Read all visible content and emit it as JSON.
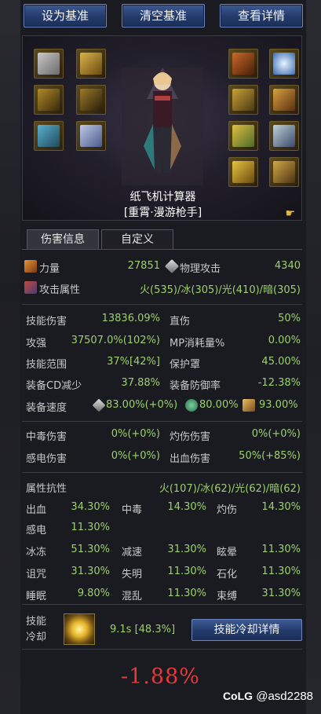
{
  "top_buttons": {
    "set_baseline": "设为基准",
    "clear_baseline": "清空基准",
    "view_details": "查看详情"
  },
  "character": {
    "name": "纸飞机计算器",
    "title": "[重霄·漫游枪手]"
  },
  "tabs": [
    {
      "label": "伤害信息",
      "active": true
    },
    {
      "label": "自定义",
      "active": false
    }
  ],
  "main_stat": {
    "label": "力量",
    "value": "27851",
    "attack_label": "物理攻击",
    "attack_value": "4340"
  },
  "element_attack": {
    "label": "攻击属性",
    "value": "火(535)/冰(305)/光(410)/暗(305)"
  },
  "stats": {
    "skill_damage": {
      "label": "技能伤害",
      "value": "13836.09%"
    },
    "direct_damage": {
      "label": "直伤",
      "value": "50%"
    },
    "attack_power": {
      "label": "攻强",
      "value": "37507.0%(102%)"
    },
    "mp_cost": {
      "label": "MP消耗量%",
      "value": "0.00%"
    },
    "skill_range": {
      "label": "技能范围",
      "value": "37%[42%]"
    },
    "shield": {
      "label": "保护罩",
      "value": "45.00%"
    },
    "cd_reduction": {
      "label": "装备CD减少",
      "value": "37.88%"
    },
    "defense_rate": {
      "label": "装备防御率",
      "value": "-12.38%"
    },
    "speed": {
      "label": "装备速度",
      "attack_speed": "83.00%(+0%)",
      "cast_speed": "80.00%",
      "move_speed": "93.00%"
    }
  },
  "status_damage": {
    "poison": {
      "label": "中毒伤害",
      "value": "0%(+0%)"
    },
    "burn": {
      "label": "灼伤伤害",
      "value": "0%(+0%)"
    },
    "shock": {
      "label": "感电伤害",
      "value": "0%(+0%)"
    },
    "bleed": {
      "label": "出血伤害",
      "value": "50%(+85%)"
    }
  },
  "resistance": {
    "label": "属性抗性",
    "value": "火(107)/冰(62)/光(62)/暗(62)",
    "rows": [
      [
        {
          "label": "出血",
          "value": "34.30%"
        },
        {
          "label": "中毒",
          "value": "14.30%"
        },
        {
          "label": "灼伤",
          "value": "14.30%"
        }
      ],
      [
        {
          "label": "感电",
          "value": "11.30%"
        }
      ],
      [
        {
          "label": "冰冻",
          "value": "51.30%"
        },
        {
          "label": "减速",
          "value": "31.30%"
        },
        {
          "label": "眩晕",
          "value": "11.30%"
        }
      ],
      [
        {
          "label": "诅咒",
          "value": "31.30%"
        },
        {
          "label": "失明",
          "value": "11.30%"
        },
        {
          "label": "石化",
          "value": "11.30%"
        }
      ],
      [
        {
          "label": "睡眠",
          "value": "9.80%"
        },
        {
          "label": "混乱",
          "value": "11.30%"
        },
        {
          "label": "束缚",
          "value": "31.30%"
        }
      ]
    ]
  },
  "skill_cd": {
    "label_line1": "技能",
    "label_line2": "冷却",
    "value": "9.1s [48.3%]",
    "button": "技能冷却详情"
  },
  "result": "-1.88%",
  "watermark": {
    "brand": "CoLG",
    "user": "@asd2288"
  },
  "colors": {
    "value_green": "#9bd06c",
    "negative_red": "#e23a3a",
    "button_blue": "#233a6b"
  }
}
